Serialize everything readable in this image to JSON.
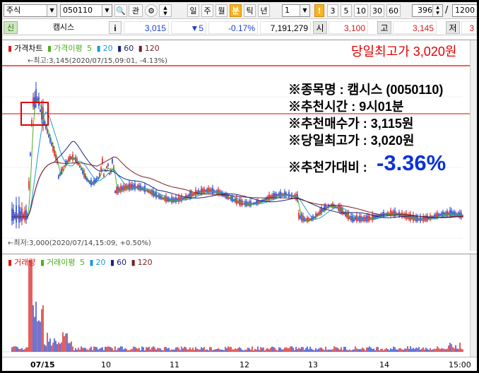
{
  "toolbar": {
    "market_select": "주식",
    "code_input": "050110",
    "search_btn": "🔍",
    "gwan_btn": "관",
    "periods": [
      "일",
      "주",
      "월",
      "분",
      "틱",
      "년"
    ],
    "active_period": "분",
    "interval_value": "1",
    "interval_marker": "!",
    "minute_options": [
      "3",
      "5",
      "10",
      "30",
      "60"
    ],
    "count_value": "396",
    "slash": "/",
    "total_count": "1200"
  },
  "quote": {
    "badge": "신",
    "stock_name": "캠시스",
    "info_icon": "i",
    "price": "3,015",
    "change": "▼5",
    "change_rate": "-0.17%",
    "volume": "7,191,279",
    "open_label": "시",
    "open_value": "3,100",
    "high_label": "고",
    "high_value": "3,145",
    "low_label": "저",
    "low_value": "3"
  },
  "price_panel": {
    "title": "가격차트",
    "ma_label": "가격이평",
    "ma_periods": [
      "5",
      "20",
      "60",
      "120"
    ],
    "high_annotation": "←최고:3,145(2020/07/15,09:01, -4.13%)",
    "low_annotation": "←최저:3,000(2020/07/14,15:09, +0.50%)",
    "day_high_banner": "당일최고가 3,020원"
  },
  "recommendation": {
    "name_line": "※종목명 : 캠시스 (0050110)",
    "time_line": "※추천시간 : 9시01분",
    "buy_line": "※추천매수가 : 3,115원",
    "high_line": "※당일최고가 : 3,020원",
    "ratio_label": "※추천가대비 : ",
    "ratio_value": "-3.36%"
  },
  "volume_panel": {
    "title": "거래량",
    "ma_label": "거래이평",
    "ma_periods": [
      "5",
      "20",
      "60",
      "120"
    ]
  },
  "x_axis": {
    "labels": [
      "07/15",
      "10",
      "11",
      "12",
      "13",
      "14",
      "15:00"
    ]
  },
  "colors": {
    "ma5": "#4caf1f",
    "ma20": "#1e9ad6",
    "ma60": "#1a237e",
    "ma120": "#7b1f1f",
    "up": "#d81b1b",
    "down": "#1f3fd0",
    "banner": "#e30000",
    "ratio": "#0b33d6"
  }
}
